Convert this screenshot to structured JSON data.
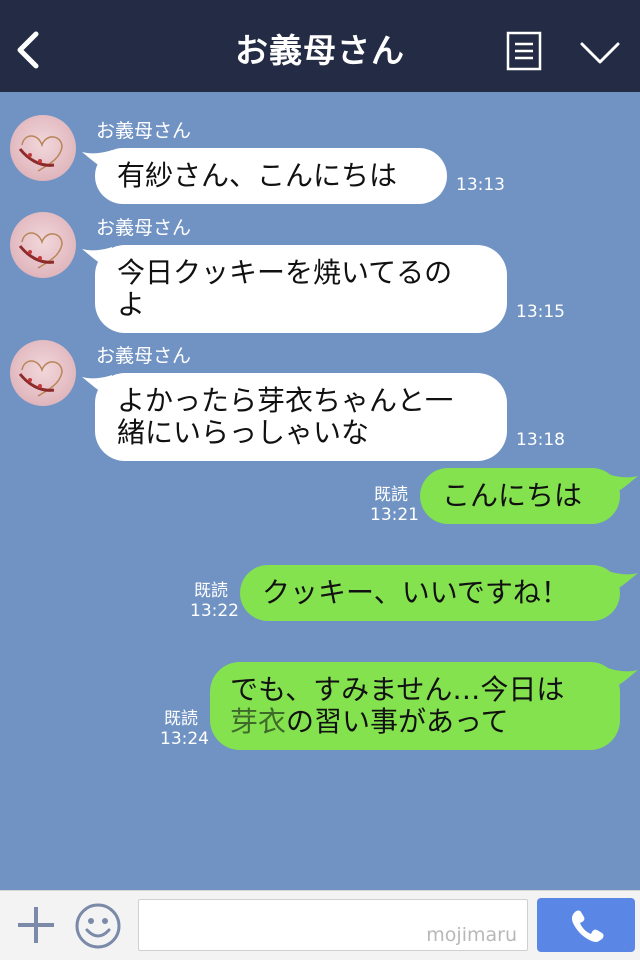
{
  "header": {
    "title": "お義母さん",
    "back_icon": "chevron-left-icon",
    "menu_icon": "list-menu-icon",
    "collapse_icon": "chevron-down-icon"
  },
  "messages": [
    {
      "sender": "お義母さん",
      "text": "有紗さん、こんにちは",
      "time": "13:13"
    },
    {
      "sender": "お義母さん",
      "text": "今日クッキーを焼いてるの\nよ",
      "time": "13:15"
    },
    {
      "sender": "お義母さん",
      "text": "よかったら芽衣ちゃんと一\n緒にいらっしゃいな",
      "time": "13:18"
    },
    {
      "read": "既読",
      "text": "こんにちは",
      "time": "13:21"
    },
    {
      "read": "既読",
      "text": "クッキー、いいですね！",
      "time": "13:22"
    },
    {
      "read": "既読",
      "text_line1": "でも、すみません…今日は",
      "text_line2_highlight": "芽衣",
      "text_line2_rest": "の習い事があって",
      "time": "13:24"
    }
  ],
  "footer": {
    "add_icon": "plus-icon",
    "emoji_icon": "smiley-icon",
    "input_value": "",
    "watermark": "mojimaru",
    "call_icon": "phone-icon"
  },
  "colors": {
    "header_bg": "#232c44",
    "chat_bg": "#7193c3",
    "incoming_bubble": "#ffffff",
    "outgoing_bubble": "#84e24f",
    "highlight_text": "#3f6b2a",
    "call_button": "#5a87e6"
  }
}
